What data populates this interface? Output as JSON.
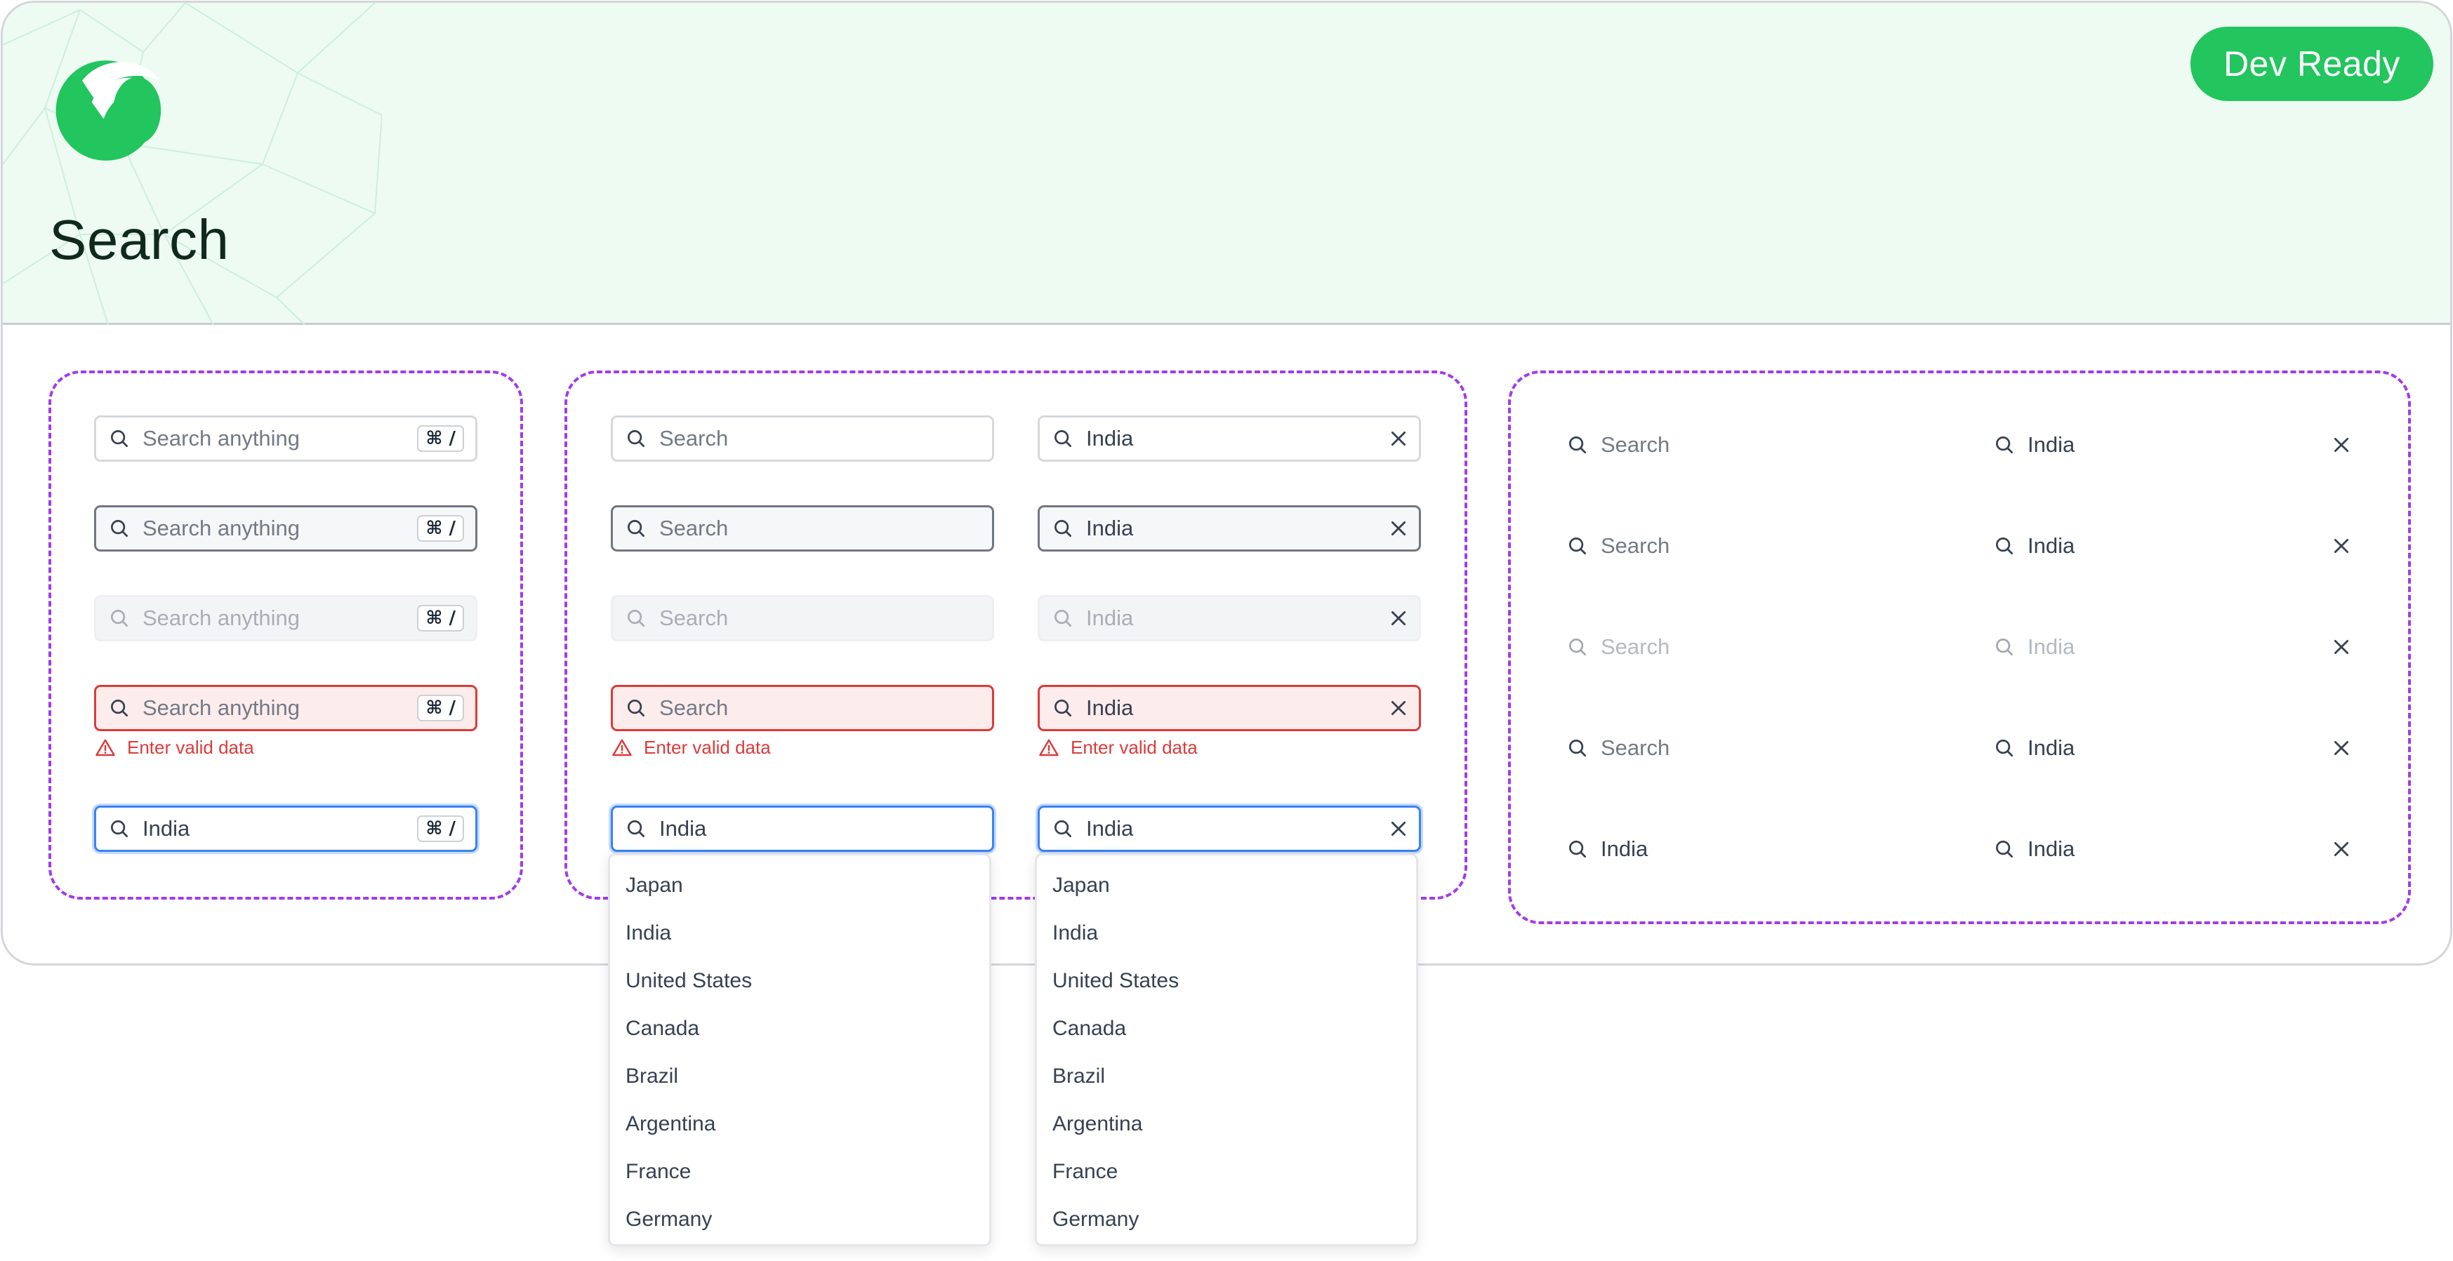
{
  "header": {
    "title": "Search",
    "status_badge": "Dev Ready",
    "brand_color": "#22c55e",
    "background_color": "#edfbf2"
  },
  "group_shortcut": {
    "placeholder": "Search anything",
    "shortcut": "⌘ /",
    "focus_value": "India",
    "error_message": "Enter valid data"
  },
  "group_select": {
    "placeholder": "Search",
    "value": "India",
    "error_message": "Enter valid data",
    "options": [
      "Japan",
      "India",
      "United States",
      "Canada",
      "Brazil",
      "Argentina",
      "France",
      "Germany"
    ]
  },
  "group_borderless": {
    "placeholder": "Search",
    "value": "India"
  },
  "colors": {
    "group_outline": "#a13ce8",
    "error": "#dc3b3b",
    "focus": "#3b82f6"
  },
  "icons": {
    "search": "search-icon",
    "clear": "close-icon",
    "warning": "warning-icon",
    "logo": "brand-logo"
  }
}
